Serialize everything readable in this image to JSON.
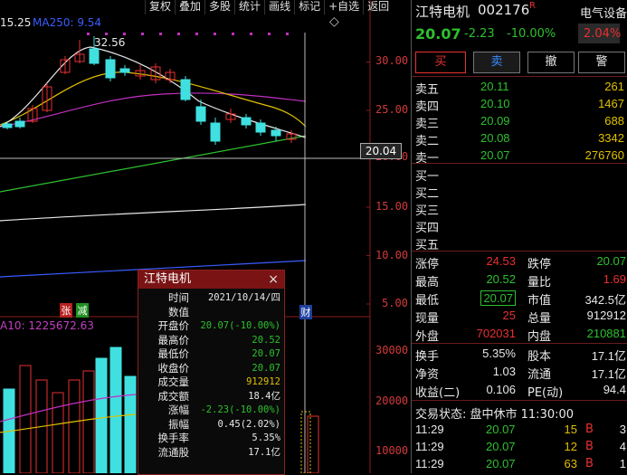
{
  "toolbar": {
    "items": [
      "复权",
      "叠加",
      "多股",
      "统计",
      "画线",
      "标记",
      "+自选",
      "返回"
    ]
  },
  "chart": {
    "ma_fragment": "15.25",
    "ma250_label": "MA250: 9.54",
    "high_label": "32.56",
    "price_ticks": [
      "30.00",
      "25.00",
      "20.00",
      "15.00",
      "10.00",
      "5.00"
    ],
    "cursor_price": "20.04",
    "vol_ma_label": "A10: 1225672.63",
    "vol_ticks": [
      "30000",
      "20000",
      "10000"
    ],
    "tag_zhang": "张",
    "tag_jian": "减",
    "tag_cai": "财",
    "diamond": "◇"
  },
  "tooltip": {
    "title": "江特电机",
    "close": "×",
    "rows": [
      {
        "label": "时间",
        "value": "2021/10/14/四",
        "color": "#e8e8e8"
      },
      {
        "label": "数值",
        "value": "",
        "color": "#e8e8e8"
      },
      {
        "label": "开盘价",
        "value": "20.07(-10.00%)",
        "color": "#2ec02e"
      },
      {
        "label": "最高价",
        "value": "20.52",
        "color": "#2ec02e"
      },
      {
        "label": "最低价",
        "value": "20.07",
        "color": "#2ec02e"
      },
      {
        "label": "收盘价",
        "value": "20.07",
        "color": "#2ec02e"
      },
      {
        "label": "成交量",
        "value": "912912",
        "color": "#e0c000"
      },
      {
        "label": "成交额",
        "value": "18.4亿",
        "color": "#e8e8e8"
      },
      {
        "label": "涨幅",
        "value": "-2.23(-10.00%)",
        "color": "#2ec02e"
      },
      {
        "label": "振幅",
        "value": "0.45(2.02%)",
        "color": "#e8e8e8"
      },
      {
        "label": "换手率",
        "value": "5.35%",
        "color": "#e8e8e8"
      },
      {
        "label": "流通股",
        "value": "17.1亿",
        "color": "#e8e8e8"
      }
    ]
  },
  "stock": {
    "name": "江特电机",
    "code": "002176",
    "badge": "R",
    "sector": "电气设备",
    "price": "20.07",
    "change": "-2.23",
    "change_pct": "-10.00%",
    "sector_pct": "2.04%"
  },
  "buttons": {
    "buy": "买",
    "sell": "卖",
    "cancel": "撤",
    "alert": "警"
  },
  "asks": [
    {
      "label": "卖五",
      "price": "20.11",
      "vol": "261"
    },
    {
      "label": "卖四",
      "price": "20.10",
      "vol": "1467"
    },
    {
      "label": "卖三",
      "price": "20.09",
      "vol": "688"
    },
    {
      "label": "卖二",
      "price": "20.08",
      "vol": "3342"
    },
    {
      "label": "卖一",
      "price": "20.07",
      "vol": "276760"
    }
  ],
  "bids": [
    "买一",
    "买二",
    "买三",
    "买四",
    "买五"
  ],
  "stats": [
    {
      "l1": "涨停",
      "v1": "24.53",
      "c1": "#e83030",
      "l2": "跌停",
      "v2": "20.07",
      "c2": "#2ec02e"
    },
    {
      "l1": "最高",
      "v1": "20.52",
      "c1": "#2ec02e",
      "l2": "量比",
      "v2": "1.69",
      "c2": "#e83030"
    },
    {
      "l1": "最低",
      "v1": "20.07",
      "c1": "#2ec02e",
      "l2": "市值",
      "v2": "342.5亿",
      "c2": "#e8e8e8"
    },
    {
      "l1": "现量",
      "v1": "25",
      "c1": "#e83030",
      "l2": "总量",
      "v2": "912912",
      "c2": "#e8e8e8"
    },
    {
      "l1": "外盘",
      "v1": "702031",
      "c1": "#e83030",
      "l2": "内盘",
      "v2": "210881",
      "c2": "#2ec02e"
    }
  ],
  "stats2": [
    {
      "l1": "换手",
      "v1": "5.35%",
      "l2": "股本",
      "v2": "17.1亿"
    },
    {
      "l1": "净资",
      "v1": "1.03",
      "l2": "流通",
      "v2": "17.1亿"
    },
    {
      "l1": "收益(二)",
      "v1": "0.106",
      "l2": "PE(动)",
      "v2": "94.4"
    }
  ],
  "trade_status": "交易状态: 盘中休市 11:30:00",
  "ticks": [
    {
      "time": "11:29",
      "price": "20.07",
      "vol": "15",
      "side": "B",
      "n": "3"
    },
    {
      "time": "11:29",
      "price": "20.07",
      "vol": "12",
      "side": "B",
      "n": "4"
    },
    {
      "time": "11:29",
      "price": "20.07",
      "vol": "63",
      "side": "B",
      "n": "1"
    }
  ]
}
